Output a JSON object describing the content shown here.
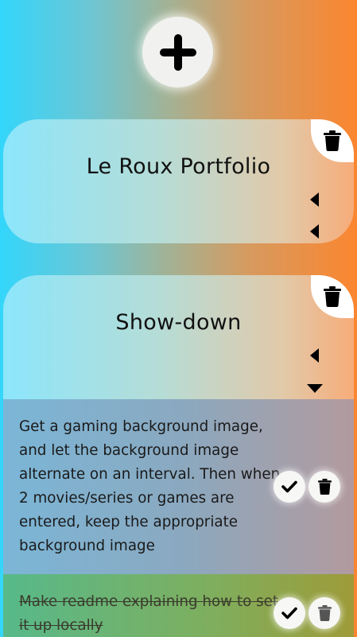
{
  "add_button": {
    "icon": "plus-icon"
  },
  "projects": [
    {
      "title": "Le Roux Portfolio",
      "expanded": false
    },
    {
      "title": "Show-down",
      "expanded": true,
      "todos": [
        {
          "text": "Get a gaming background image, and let the background image alternate on an interval. Then when 2 movies/series or games are entered, keep the appropriate background image",
          "completed": false
        },
        {
          "text": "Make readme explaining how to set it up locally",
          "completed": true
        }
      ]
    }
  ],
  "colors": {
    "gradient_left": "#33d6fb",
    "gradient_right": "#fb8630",
    "icon": "#000000"
  }
}
